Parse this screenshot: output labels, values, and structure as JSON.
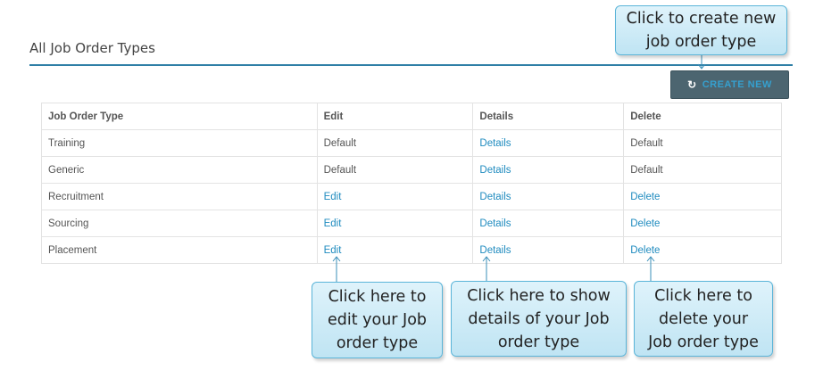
{
  "page": {
    "title": "All Job Order Types"
  },
  "toolbar": {
    "create_label": "CREATE NEW",
    "create_icon": "refresh-icon"
  },
  "table": {
    "headers": [
      "Job Order Type",
      "Edit",
      "Details",
      "Delete"
    ],
    "rows": [
      {
        "type": "Training",
        "edit": "Default",
        "details": "Details",
        "delete": "Default"
      },
      {
        "type": "Generic",
        "edit": "Default",
        "details": "Details",
        "delete": "Default"
      },
      {
        "type": "Recruitment",
        "edit": "Edit",
        "details": "Details",
        "delete": "Delete"
      },
      {
        "type": "Sourcing",
        "edit": "Edit",
        "details": "Details",
        "delete": "Delete"
      },
      {
        "type": "Placement",
        "edit": "Edit",
        "details": "Details",
        "delete": "Delete"
      }
    ]
  },
  "callouts": {
    "create": [
      "Click to create new",
      "job order type"
    ],
    "edit": [
      "Click here to",
      "edit your Job",
      "order type"
    ],
    "details": [
      "Click here to show",
      "details of your Job",
      "order type"
    ],
    "delete": [
      "Click here to",
      "delete your",
      "Job order type"
    ]
  },
  "colors": {
    "accent": "#2f7fa6",
    "link": "#1f8bbf",
    "button_bg": "#4c6570",
    "callout_bg": "#cdeaf6"
  }
}
